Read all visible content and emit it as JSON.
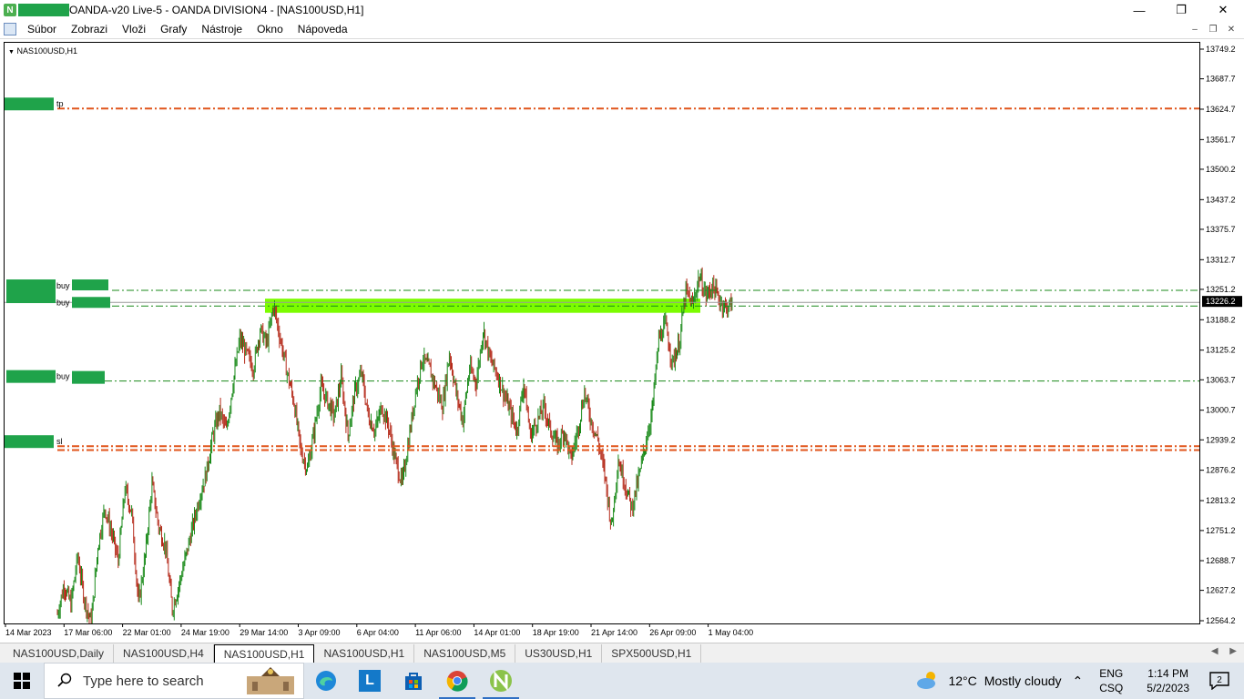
{
  "window": {
    "title": "OANDA-v20 Live-5 - OANDA DIVISION4 - [NAS100USD,H1]",
    "controls": [
      "minimize",
      "restore",
      "close"
    ]
  },
  "menu": {
    "items": [
      "Súbor",
      "Zobrazi",
      "Vloži",
      "Grafy",
      "Nástroje",
      "Okno",
      "Nápoveda"
    ]
  },
  "chart": {
    "symbol_label": "NAS100USD,H1",
    "current_price": "13226.2",
    "price_ticks": [
      "13749.2",
      "13687.7",
      "13624.7",
      "13561.7",
      "13500.2",
      "13437.2",
      "13375.7",
      "13312.7",
      "13251.2",
      "13188.2",
      "13125.2",
      "13063.7",
      "13000.7",
      "12939.2",
      "12876.2",
      "12813.2",
      "12751.2",
      "12688.7",
      "12627.2",
      "12564.2"
    ],
    "time_ticks": [
      "14 Mar 2023",
      "17 Mar 06:00",
      "22 Mar 01:00",
      "24 Mar 19:00",
      "29 Mar 14:00",
      "3 Apr 09:00",
      "6 Apr 04:00",
      "11 Apr 06:00",
      "14 Apr 01:00",
      "18 Apr 19:00",
      "21 Apr 14:00",
      "26 Apr 09:00",
      "1 May 04:00"
    ],
    "order_labels": {
      "tp": "tp",
      "buy1": "buy",
      "buy2": "buy",
      "buy3": "buy",
      "sl": "sl"
    },
    "colors": {
      "bull": "#1a8a1a",
      "bear": "#b52a1a",
      "tp_sl_line": "#e0551b",
      "buy_line": "#1a8a1a",
      "zone": "#7cfc00",
      "redaction": "#1fa34a"
    }
  },
  "chart_data": {
    "type": "candlestick",
    "title": "NAS100USD,H1",
    "ylim": [
      12564.2,
      13749.2
    ],
    "levels": {
      "tp": 13628,
      "buy_upper": 13251,
      "buy_lower": 13226,
      "buy_low": 13063,
      "sl_upper": 12928,
      "sl_lower": 12920
    },
    "zone": {
      "from": 13230,
      "to": 13212
    },
    "close_path": [
      12580,
      12640,
      12600,
      12700,
      12610,
      12560,
      12720,
      12800,
      12750,
      12690,
      12840,
      12790,
      12600,
      12700,
      12850,
      12760,
      12720,
      12590,
      12640,
      12700,
      12760,
      12820,
      12870,
      12950,
      13000,
      12960,
      13060,
      13150,
      13120,
      13090,
      13170,
      13140,
      13220,
      13150,
      13080,
      13020,
      12920,
      12880,
      12960,
      13050,
      13020,
      12990,
      13070,
      12950,
      13040,
      13080,
      12990,
      12960,
      13010,
      12970,
      12900,
      12850,
      12940,
      13040,
      13110,
      13090,
      13050,
      13010,
      13120,
      13040,
      12980,
      13090,
      13060,
      13170,
      13110,
      13080,
      13040,
      13000,
      12960,
      13060,
      12950,
      12980,
      13010,
      12960,
      12930,
      12960,
      12900,
      12960,
      13040,
      12980,
      12940,
      12870,
      12760,
      12900,
      12850,
      12800,
      12860,
      12930,
      13000,
      13150,
      13180,
      13100,
      13140,
      13250,
      13220,
      13280,
      13240,
      13260,
      13230,
      13215,
      13226
    ]
  },
  "tabs": {
    "items": [
      "NAS100USD,Daily",
      "NAS100USD,H4",
      "NAS100USD,H1",
      "NAS100USD,H1",
      "NAS100USD,M5",
      "US30USD,H1",
      "SPX500USD,H1"
    ],
    "active_index": 2
  },
  "taskbar": {
    "search_placeholder": "Type here to search",
    "weather_temp": "12°C",
    "weather_desc": "Mostly cloudy",
    "lang_top": "ENG",
    "lang_bottom": "CSQ",
    "time": "1:14 PM",
    "date": "5/2/2023",
    "notification_count": "2"
  }
}
